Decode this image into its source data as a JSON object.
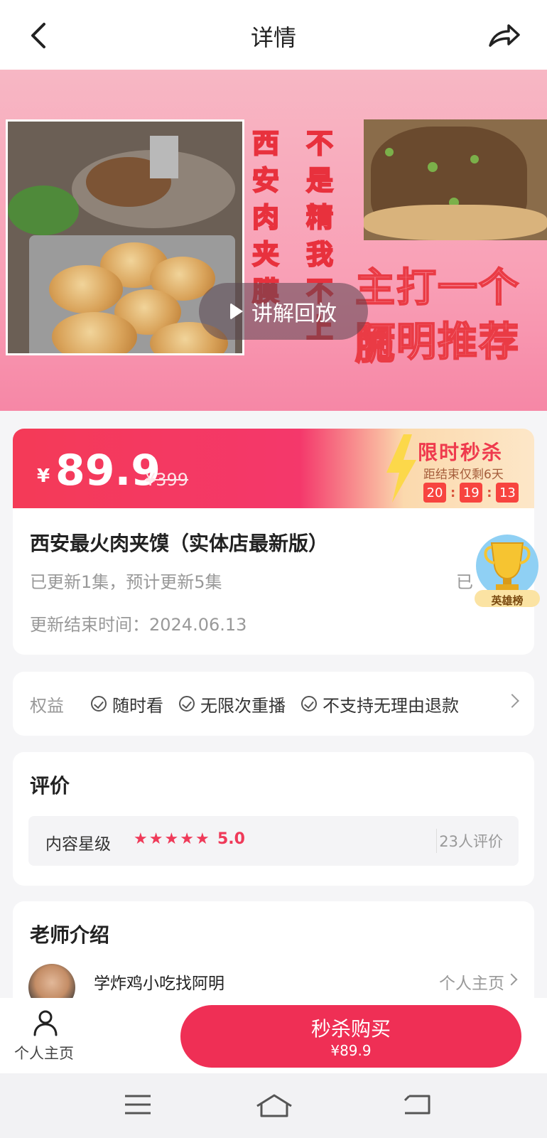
{
  "header": {
    "title": "详情"
  },
  "banner": {
    "left_vertical": "西安肉夹膜",
    "right_vertical": "不是精我不上",
    "slogan_1": "主打一个脆",
    "slogan_2": "阿明推荐",
    "replay_label": "讲解回放"
  },
  "price": {
    "currency": "¥",
    "current": "89.9",
    "original": "¥399",
    "flash_title": "限时秒杀",
    "flash_sub": "距结束仅剩6天",
    "timer": [
      "20",
      "19",
      "13"
    ]
  },
  "product": {
    "title": "西安最火肉夹馍（实体店最新版）",
    "update_info": "已更新1集，预计更新5集",
    "side_text": "已",
    "end_time": "更新结束时间：2024.06.13",
    "hero_badge": "英雄榜"
  },
  "benefits": {
    "label": "权益",
    "items": [
      "随时看",
      "无限次重播",
      "不支持无理由退款"
    ]
  },
  "reviews": {
    "title": "评价",
    "label": "内容星级",
    "stars": 5,
    "score": "5.0",
    "count": "23人评价"
  },
  "teacher": {
    "title": "老师介绍",
    "name": "学炸鸡小吃找阿明",
    "link": "个人主页"
  },
  "actionbar": {
    "profile_label": "个人主页",
    "buy_label": "秒杀购买",
    "buy_price": "¥89.9"
  },
  "colors": {
    "accent": "#ef2f55",
    "star": "#ef3a59"
  }
}
